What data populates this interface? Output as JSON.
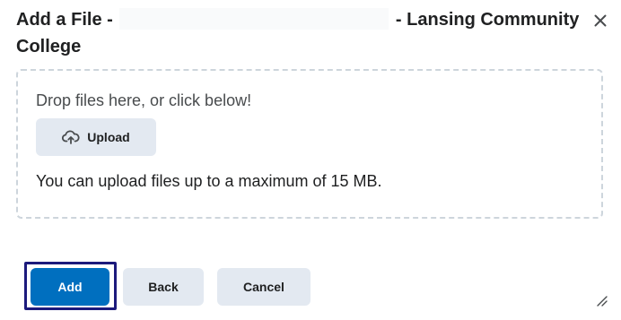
{
  "dialog": {
    "title_prefix": "Add a File -",
    "title_suffix": "- Lansing Community",
    "title_line2": "College",
    "close_icon": "close-icon"
  },
  "dropzone": {
    "prompt": "Drop files here, or click below!",
    "upload_label": "Upload",
    "upload_icon": "cloud-upload-icon",
    "limit_text": "You can upload files up to a maximum of 15 MB."
  },
  "footer": {
    "add_label": "Add",
    "back_label": "Back",
    "cancel_label": "Cancel"
  },
  "colors": {
    "primary": "#006fbf",
    "secondary_button": "#e3e9f1",
    "focus_ring": "#1c1a7c",
    "dropzone_border": "#cdd5dc"
  }
}
